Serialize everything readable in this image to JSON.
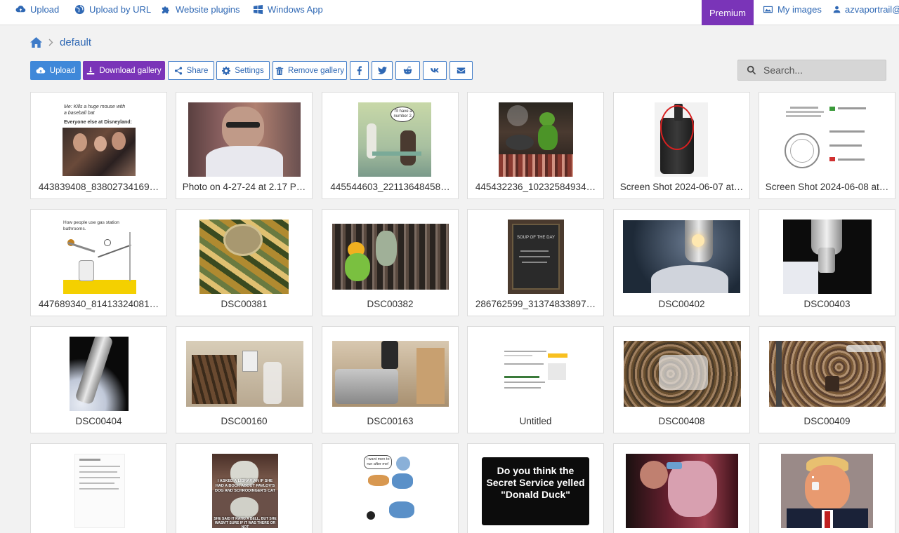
{
  "nav": {
    "upload": "Upload",
    "upload_by_url": "Upload by URL",
    "website_plugins": "Website plugins",
    "windows_app": "Windows App",
    "premium": "Premium",
    "my_images": "My images",
    "account": "azvaportrail@g"
  },
  "breadcrumb": {
    "current": "default"
  },
  "toolbar": {
    "upload": "Upload",
    "download_gallery": "Download gallery",
    "share": "Share",
    "settings": "Settings",
    "remove_gallery": "Remove gallery"
  },
  "search": {
    "placeholder": "Search..."
  },
  "colors": {
    "accent": "#3f88d9",
    "premium": "#7a34b8",
    "link": "#2f68b4"
  },
  "gallery": {
    "items": [
      {
        "caption": "443839408_83802734169…",
        "meme_line1": "Me:  Kills a huge mouse with",
        "meme_line2": "a baseball bat",
        "meme_line3": "Everyone else at Disneyland:"
      },
      {
        "caption": "Photo on 4-27-24 at 2.17 P…"
      },
      {
        "caption": "445544603_22113648458…",
        "bubble": "I'll have a number 2."
      },
      {
        "caption": "445432236_10232584934…"
      },
      {
        "caption": "Screen Shot 2024-06-07 at…"
      },
      {
        "caption": "Screen Shot 2024-06-08 at…"
      },
      {
        "caption": "447689340_81413324081…",
        "meme_line1": "How people use gas station",
        "meme_line2": "bathrooms."
      },
      {
        "caption": "DSC00381"
      },
      {
        "caption": "DSC00382"
      },
      {
        "caption": "286762599_31374833897…",
        "board": "SOUP OF THE DAY"
      },
      {
        "caption": "DSC00402"
      },
      {
        "caption": "DSC00403"
      },
      {
        "caption": "DSC00404"
      },
      {
        "caption": "DSC00160"
      },
      {
        "caption": "DSC00163"
      },
      {
        "caption": "Untitled"
      },
      {
        "caption": "DSC00408"
      },
      {
        "caption": "DSC00409"
      },
      {
        "caption": ""
      },
      {
        "caption": "",
        "meme_top": "I ASKED A LIBRARIAN IF SHE HAD A BOOK ABOUT PAVLOV'S DOG AND SCHRODINGER'S CAT",
        "meme_bottom": "SHE SAID IT RANG A BELL, BUT SHE WASN'T SURE IF IT WAS THERE OR NOT"
      },
      {
        "caption": "",
        "bubble": "I want men to run after me!"
      },
      {
        "caption": "",
        "sign": "Do you think the Secret Service yelled \"Donald Duck\""
      },
      {
        "caption": ""
      },
      {
        "caption": ""
      }
    ]
  }
}
